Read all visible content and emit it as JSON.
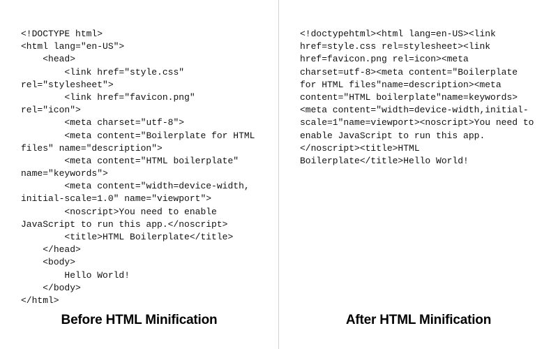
{
  "left": {
    "caption": "Before HTML Minification",
    "code": "<!DOCTYPE html>\n<html lang=\"en-US\">\n    <head>\n        <link href=\"style.css\" rel=\"stylesheet\">\n        <link href=\"favicon.png\" rel=\"icon\">\n        <meta charset=\"utf-8\">\n        <meta content=\"Boilerplate for HTML files\" name=\"description\">\n        <meta content=\"HTML boilerplate\" name=\"keywords\">\n        <meta content=\"width=device-width, initial-scale=1.0\" name=\"viewport\">\n        <noscript>You need to enable JavaScript to run this app.</noscript>\n        <title>HTML Boilerplate</title>\n    </head>\n    <body>\n        Hello World!\n    </body>\n</html>"
  },
  "right": {
    "caption": "After HTML Minification",
    "code": "<!doctypehtml><html lang=en-US><link href=style.css rel=stylesheet><link href=favicon.png rel=icon><meta charset=utf-8><meta content=\"Boilerplate for HTML files\"name=description><meta content=\"HTML boilerplate\"name=keywords><meta content=\"width=device-width,initial-scale=1\"name=viewport><noscript>You need to enable JavaScript to run this app.</noscript><title>HTML Boilerplate</title>Hello World!"
  }
}
